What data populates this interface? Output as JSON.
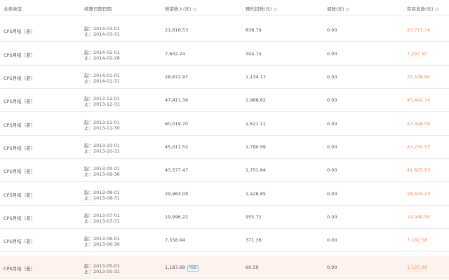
{
  "headers": {
    "type": "业务类型",
    "dates": "结算日期日期",
    "pretax": "税前收入(元)",
    "payable": "预代扣税(元)",
    "adjust": "调账(元)",
    "actual": "实际发放(元)"
  },
  "accent_color": "#f08c5a",
  "rows": [
    {
      "type": "CPS月结（老）",
      "start": "起：2014-03-01",
      "end": "止：2014-03-31",
      "pretax": "21,616.53",
      "payable": "838.79",
      "adjust": "0.00",
      "actual": "20,777.74"
    },
    {
      "type": "CPS月结（老）",
      "start": "起：2014-02-01",
      "end": "止：2014-02-28",
      "pretax": "7,602.24",
      "payable": "304.74",
      "adjust": "0.00",
      "actual": "7,297.50"
    },
    {
      "type": "CPS月结（老）",
      "start": "起：2014-01-01",
      "end": "止：2014-01-31",
      "pretax": "28,672.97",
      "payable": "1,134.17",
      "adjust": "0.00",
      "actual": "27,538.80"
    },
    {
      "type": "CPS月结（老）",
      "start": "起：2013-12-01",
      "end": "止：2013-12-31",
      "pretax": "47,411.36",
      "payable": "1,968.62",
      "adjust": "0.00",
      "actual": "45,442.74"
    },
    {
      "type": "CPS月结（老）",
      "start": "起：2013-11-01",
      "end": "止：2013-11-30",
      "pretax": "60,019.70",
      "payable": "2,621.11",
      "adjust": "0.00",
      "actual": "57,398.59"
    },
    {
      "type": "CPS月结（老）",
      "start": "起：2013-10-01",
      "end": "止：2013-10-31",
      "pretax": "45,011.52",
      "payable": "1,780.99",
      "adjust": "0.00",
      "actual": "43,230.53"
    },
    {
      "type": "CPS月结（老）",
      "start": "起：2013-09-01",
      "end": "止：2013-09-30",
      "pretax": "43,577.47",
      "payable": "1,751.64",
      "adjust": "0.00",
      "actual": "41,825.83"
    },
    {
      "type": "CPS月结（老）",
      "start": "起：2013-08-01",
      "end": "止：2013-08-31",
      "pretax": "29,963.08",
      "payable": "1,428.85",
      "adjust": "0.00",
      "actual": "28,534.23"
    },
    {
      "type": "CPS月结（老）",
      "start": "起：2013-07-01",
      "end": "止：2013-07-31",
      "pretax": "19,996.22",
      "payable": "955.72",
      "adjust": "0.00",
      "actual": "19,040.50"
    },
    {
      "type": "CPS月结（老）",
      "start": "起：2013-06-01",
      "end": "止：2013-06-30",
      "pretax": "7,558.94",
      "payable": "371.36",
      "adjust": "0.00",
      "actual": "7,187.58"
    },
    {
      "type": "CPS月结（老）",
      "start": "起：2013-05-01",
      "end": "止：2013-05-31",
      "pretax": "1,187.68",
      "badge": "明细",
      "payable": "60.59",
      "adjust": "0.00",
      "actual": "1,127.09"
    }
  ]
}
